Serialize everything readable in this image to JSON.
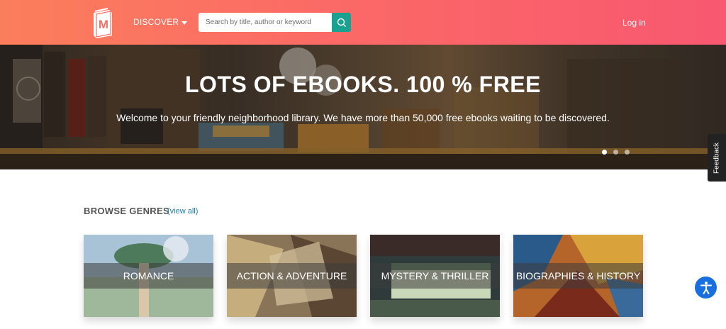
{
  "header": {
    "discover_label": "DISCOVER",
    "search_placeholder": "Search by title, author or keyword",
    "login_label": "Log in"
  },
  "hero": {
    "title": "LOTS OF EBOOKS. 100 % FREE",
    "subtitle": "Welcome to your friendly neighborhood library. We have more than 50,000 free ebooks waiting to be discovered.",
    "slide_count": 3,
    "active_slide": 1
  },
  "feedback": {
    "label": "Feedback"
  },
  "browse": {
    "title": "BROWSE GENRES",
    "view_all": "(view all)",
    "genres": [
      {
        "label": "ROMANCE"
      },
      {
        "label": "ACTION & ADVENTURE"
      },
      {
        "label": "MYSTERY & THRILLER"
      },
      {
        "label": "BIOGRAPHIES & HISTORY"
      }
    ]
  },
  "colors": {
    "header_start": "#fb7e5c",
    "header_end": "#f85870",
    "search_button": "#1ba18f",
    "link": "#1e7fa8",
    "accessibility": "#1a6fe0"
  },
  "icons": {
    "logo": "book-logo-icon",
    "search": "search-icon",
    "accessibility": "accessibility-icon"
  }
}
